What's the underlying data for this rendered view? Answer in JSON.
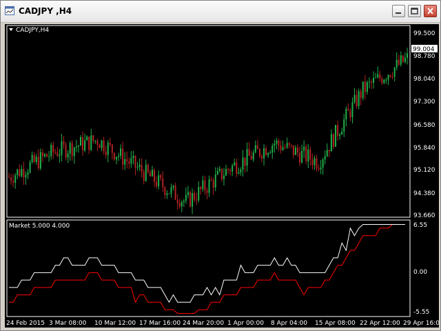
{
  "window": {
    "title": "CADJPY ,H4",
    "minimize_icon": "minimize-icon",
    "maximize_icon": "maximize-icon",
    "close_icon": "close-icon"
  },
  "main_chart": {
    "label": "CADJPY,H4",
    "current_price": "99.004",
    "price_ticks": [
      "99.500",
      "98.780",
      "98.040",
      "97.300",
      "96.580",
      "95.840",
      "95.120",
      "94.380",
      "93.660"
    ]
  },
  "indicator": {
    "label": "Market 5.000 4.000",
    "ticks": [
      "6.55",
      "0.00",
      "-5.55"
    ]
  },
  "time_axis": {
    "labels": [
      "24 Feb 2015",
      "3 Mar 08:00",
      "10 Mar 12:00",
      "17 Mar 16:00",
      "24 Mar 20:00",
      "1 Apr 00:00",
      "8 Apr 04:00",
      "15 Apr 08:00",
      "22 Apr 12:00",
      "29 Apr 16:00"
    ]
  },
  "colors": {
    "background": "#000000",
    "bull_candle": "#22b14c",
    "bear_candle": "#b22222",
    "grid_text": "#ffffff",
    "indicator_line_1": "#ffffff",
    "indicator_line_2": "#ff0000",
    "price_label_bg": "#ffffff"
  },
  "chart_data": {
    "type": "line",
    "x": [
      "24 Feb 2015",
      "3 Mar 08:00",
      "10 Mar 12:00",
      "17 Mar 16:00",
      "24 Mar 20:00",
      "1 Apr 00:00",
      "8 Apr 04:00",
      "15 Apr 08:00",
      "22 Apr 12:00",
      "29 Apr 16:00"
    ],
    "series": [
      {
        "name": "CADJPY,H4",
        "values": [
          94.9,
          95.7,
          96.1,
          95.1,
          94.1,
          95.2,
          96.0,
          95.4,
          97.7,
          98.7
        ]
      }
    ],
    "ylim": [
      93.66,
      99.5
    ]
  }
}
